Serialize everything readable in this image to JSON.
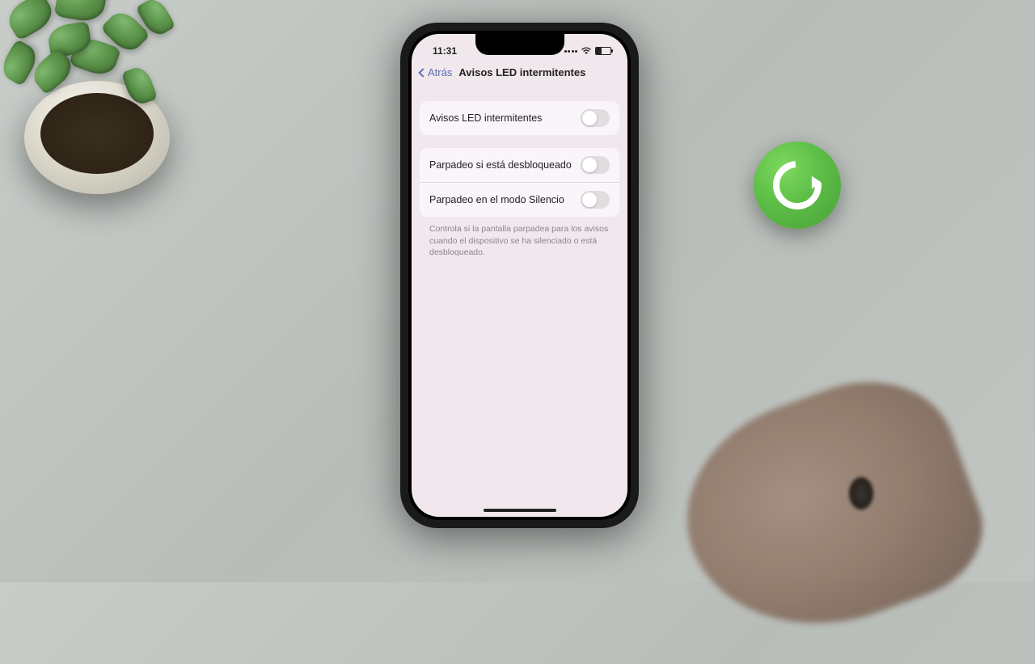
{
  "statusBar": {
    "time": "11:31"
  },
  "nav": {
    "backLabel": "Atrás",
    "title": "Avisos LED intermitentes"
  },
  "settings": {
    "group1": [
      {
        "label": "Avisos LED intermitentes",
        "on": false
      }
    ],
    "group2": [
      {
        "label": "Parpadeo si está desbloqueado",
        "on": false
      },
      {
        "label": "Parpadeo en el modo Silencio",
        "on": false
      }
    ],
    "footerNote": "Controla si la pantalla parpadea para los avisos cuando el dispositivo se ha silenciado o está desbloqueado."
  }
}
